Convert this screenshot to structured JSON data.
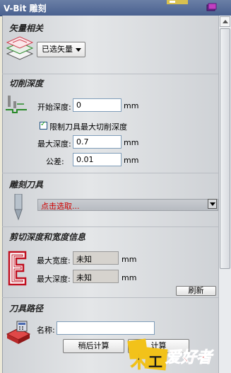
{
  "window": {
    "title": "V-Bit 雕刻"
  },
  "vector": {
    "section_title": "矢量相关",
    "select_label": "已选矢量"
  },
  "depth": {
    "section_title": "切削深度",
    "start_label": "开始深度:",
    "start_value": "0",
    "start_unit": "mm",
    "limit_label": "限制刀具最大切削深度",
    "limit_checked": true,
    "max_label": "最大深度:",
    "max_value": "0.7",
    "max_unit": "mm",
    "tol_label": "公差:",
    "tol_value": "0.01",
    "tol_unit": "mm"
  },
  "tool": {
    "section_title": "雕刻刀具",
    "select_text": "点击选取..."
  },
  "info": {
    "section_title": "剪切深度和宽度信息",
    "width_label": "最大宽度:",
    "width_value": "未知",
    "width_unit": "mm",
    "depth_label": "最大深度:",
    "depth_value": "未知",
    "depth_unit": "mm",
    "button_label": "刷新"
  },
  "toolpath": {
    "section_title": "刀具路径",
    "name_label": "名称:",
    "name_value": "",
    "later_button": "稍后计算",
    "calc_button": "计算"
  },
  "watermark": {
    "text": "爱好者"
  }
}
